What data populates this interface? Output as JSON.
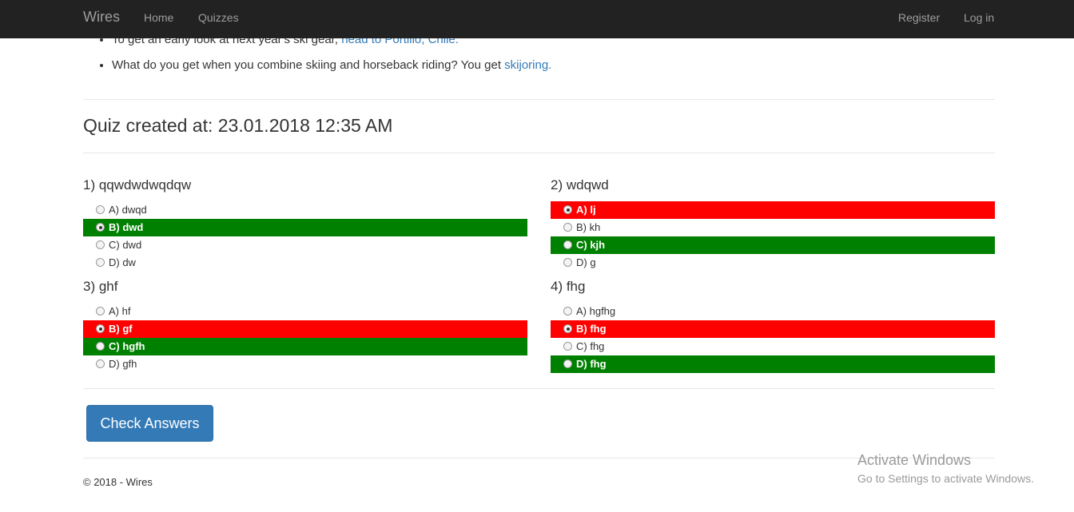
{
  "navbar": {
    "brand": "Wires",
    "links": {
      "home": "Home",
      "quizzes": "Quizzes",
      "register": "Register",
      "login": "Log in"
    }
  },
  "bullets": [
    {
      "text": "To get an early look at next year's ski gear, ",
      "link": "head to Portillo, Chile."
    },
    {
      "text": "What do you get when you combine skiing and horseback riding? You get ",
      "link": "skijoring."
    }
  ],
  "quiz_title": "Quiz created at: 23.01.2018 12:35 AM",
  "questions": [
    {
      "title": "1) qqwdwdwqdqw",
      "options": [
        {
          "label": "A) dwqd",
          "state": "none",
          "checked": false
        },
        {
          "label": "B) dwd",
          "state": "correct",
          "checked": true
        },
        {
          "label": "C) dwd",
          "state": "none",
          "checked": false
        },
        {
          "label": "D) dw",
          "state": "none",
          "checked": false
        }
      ]
    },
    {
      "title": "2) wdqwd",
      "options": [
        {
          "label": "A) lj",
          "state": "wrong",
          "checked": true
        },
        {
          "label": "B) kh",
          "state": "none",
          "checked": false
        },
        {
          "label": "C) kjh",
          "state": "correct",
          "checked": false
        },
        {
          "label": "D) g",
          "state": "none",
          "checked": false
        }
      ]
    },
    {
      "title": "3) ghf",
      "options": [
        {
          "label": "A) hf",
          "state": "none",
          "checked": false
        },
        {
          "label": "B) gf",
          "state": "wrong",
          "checked": true
        },
        {
          "label": "C) hgfh",
          "state": "correct",
          "checked": false
        },
        {
          "label": "D) gfh",
          "state": "none",
          "checked": false
        }
      ]
    },
    {
      "title": "4) fhg",
      "options": [
        {
          "label": "A) hgfhg",
          "state": "none",
          "checked": false
        },
        {
          "label": "B) fhg",
          "state": "wrong",
          "checked": true
        },
        {
          "label": "C) fhg",
          "state": "none",
          "checked": false
        },
        {
          "label": "D) fhg",
          "state": "correct",
          "checked": false
        }
      ]
    }
  ],
  "check_button": "Check Answers",
  "footer": "© 2018 - Wires",
  "watermark": {
    "line1": "Activate Windows",
    "line2": "Go to Settings to activate Windows."
  },
  "colors": {
    "navbar": "#222222",
    "wrong": "#ff0000",
    "correct": "#008000",
    "link": "#337ab7",
    "button": "#337ab7"
  }
}
